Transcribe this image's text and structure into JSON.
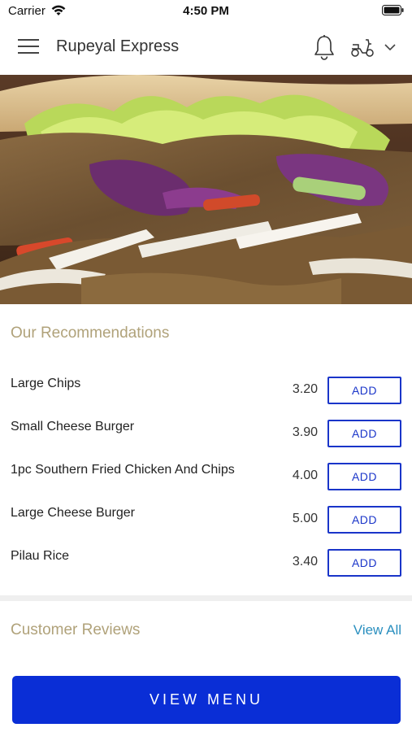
{
  "status_bar": {
    "carrier": "Carrier",
    "time": "4:50 PM"
  },
  "header": {
    "title": "Rupeyal Express",
    "icons": [
      "menu-icon",
      "bell-icon",
      "scooter-icon",
      "chevron-down-icon"
    ]
  },
  "hero": {
    "icon": "doner-kebab-photo"
  },
  "recommendations": {
    "title": "Our Recommendations",
    "items": [
      {
        "name": "Large Chips",
        "price": "3.20",
        "button": "ADD"
      },
      {
        "name": "Small Cheese Burger",
        "price": "3.90",
        "button": "ADD"
      },
      {
        "name": "1pc Southern Fried Chicken And Chips",
        "price": "4.00",
        "button": "ADD"
      },
      {
        "name": "Large Cheese Burger",
        "price": "5.00",
        "button": "ADD"
      },
      {
        "name": "Pilau Rice",
        "price": "3.40",
        "button": "ADD"
      }
    ]
  },
  "reviews": {
    "title": "Customer Reviews",
    "view_all": "View All"
  },
  "footer": {
    "view_menu": "VIEW MENU"
  },
  "colors": {
    "accent": "#0a2ed6",
    "add_button": "#1a35c9",
    "section_title": "#b0a27a",
    "link": "#2a8fbf"
  }
}
